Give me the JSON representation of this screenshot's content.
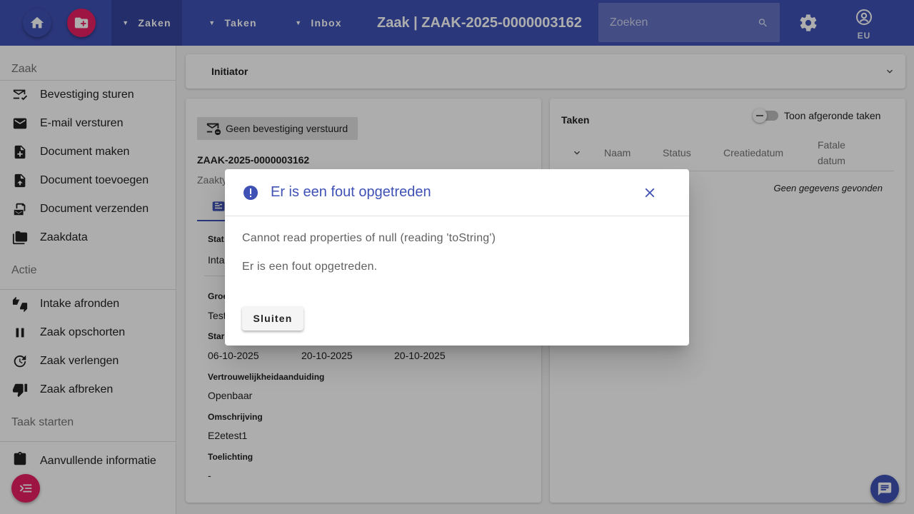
{
  "topbar": {
    "menus": [
      {
        "label": "Zaken"
      },
      {
        "label": "Taken"
      },
      {
        "label": "Inbox"
      }
    ],
    "title": "Zaak | ZAAK-2025-0000003162",
    "search_placeholder": "Zoeken",
    "user_label": "EU",
    "icons": {
      "home": "home-icon",
      "new_case": "folder-add-icon",
      "search": "search-icon",
      "settings": "gear-icon",
      "user": "account-circle-icon"
    }
  },
  "sidebar": {
    "sections": [
      {
        "title": "Zaak",
        "items": [
          {
            "label": "Bevestiging sturen",
            "icon": "mail-check-icon"
          },
          {
            "label": "E-mail versturen",
            "icon": "mail-icon"
          },
          {
            "label": "Document maken",
            "icon": "note-add-icon"
          },
          {
            "label": "Document toevoegen",
            "icon": "upload-file-icon"
          },
          {
            "label": "Document verzenden",
            "icon": "send-document-icon"
          },
          {
            "label": "Zaakdata",
            "icon": "folder-copy-icon"
          }
        ]
      },
      {
        "title": "Actie",
        "items": [
          {
            "label": "Intake afronden",
            "icon": "thumbs-up-down-icon"
          },
          {
            "label": "Zaak opschorten",
            "icon": "pause-icon"
          },
          {
            "label": "Zaak verlengen",
            "icon": "update-icon"
          },
          {
            "label": "Zaak afbreken",
            "icon": "thumb-down-icon"
          }
        ]
      },
      {
        "title": "Taak starten",
        "items": [
          {
            "label": "Aanvullende informatie",
            "icon": "clipboard-icon"
          }
        ]
      }
    ]
  },
  "initiator": {
    "title": "Initiator"
  },
  "case": {
    "chip_label": "Geen bevestiging verstuurd",
    "id": "ZAAK-2025-0000003162",
    "type_label_partial": "Zaakty",
    "status_label_partial": "Stat",
    "status_value_partial": "Inta",
    "group_label_partial": "Groe",
    "group_value_partial": "Test",
    "start_label_partial": "Star",
    "dates": [
      "06-10-2025",
      "20-10-2025",
      "20-10-2025"
    ],
    "confidentiality_label": "Vertrouwelijkheidaanduiding",
    "confidentiality_value": "Openbaar",
    "description_label": "Omschrijving",
    "description_value": "E2etest1",
    "explanation_label": "Toelichting",
    "explanation_value": "-"
  },
  "tasks": {
    "title": "Taken",
    "toggle_label": "Toon afgeronde taken",
    "columns": [
      "Naam",
      "Status",
      "Creatiedatum",
      "Fatale datum"
    ],
    "empty_text": "Geen gegevens gevonden"
  },
  "dialog": {
    "title": "Er is een fout opgetreden",
    "message": "Cannot read properties of null (reading 'toString')",
    "submessage": "Er is een fout opgetreden.",
    "button_label": "Sluiten"
  },
  "colors": {
    "primary": "#3f51b5",
    "accent": "#e91e63"
  }
}
